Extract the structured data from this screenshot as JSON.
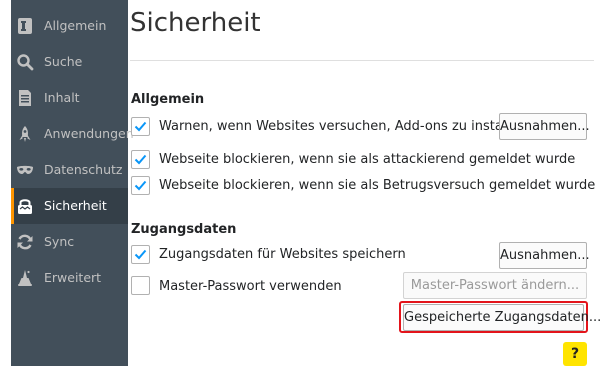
{
  "sidebar": {
    "items": [
      {
        "label": "Allgemein",
        "icon": "general-icon"
      },
      {
        "label": "Suche",
        "icon": "search-icon"
      },
      {
        "label": "Inhalt",
        "icon": "content-icon"
      },
      {
        "label": "Anwendungen",
        "icon": "applications-icon"
      },
      {
        "label": "Datenschutz",
        "icon": "privacy-mask-icon"
      },
      {
        "label": "Sicherheit",
        "icon": "security-lock-icon",
        "selected": true
      },
      {
        "label": "Sync",
        "icon": "sync-icon"
      },
      {
        "label": "Erweitert",
        "icon": "advanced-wizard-icon"
      }
    ]
  },
  "page": {
    "title": "Sicherheit"
  },
  "general": {
    "heading": "Allgemein",
    "warn_addons": {
      "label": "Warnen, wenn Websites versuchen, Add-ons zu installieren",
      "checked": true
    },
    "exceptions_button": "Ausnahmen...",
    "block_attack": {
      "label": "Webseite blockieren, wenn sie als attackierend gemeldet wurde",
      "checked": true
    },
    "block_fraud": {
      "label": "Webseite blockieren, wenn sie als Betrugsversuch gemeldet wurde",
      "checked": true
    }
  },
  "logins": {
    "heading": "Zugangsdaten",
    "save_logins": {
      "label": "Zugangsdaten für Websites speichern",
      "checked": true
    },
    "exceptions_button": "Ausnahmen...",
    "master_password": {
      "label": "Master-Passwort verwenden",
      "checked": false
    },
    "change_master_button": "Master-Passwort ändern...",
    "saved_logins_button": "Gespeicherte Zugangsdaten..."
  },
  "help": {
    "label": "?"
  },
  "colors": {
    "sidebar_bg": "#424f5a",
    "sidebar_selected_bg": "#343f48",
    "selected_indicator": "#ff9500",
    "checkbox_check": "#0996f8",
    "highlight": "#e3141b",
    "help_bg": "#ffe400"
  }
}
